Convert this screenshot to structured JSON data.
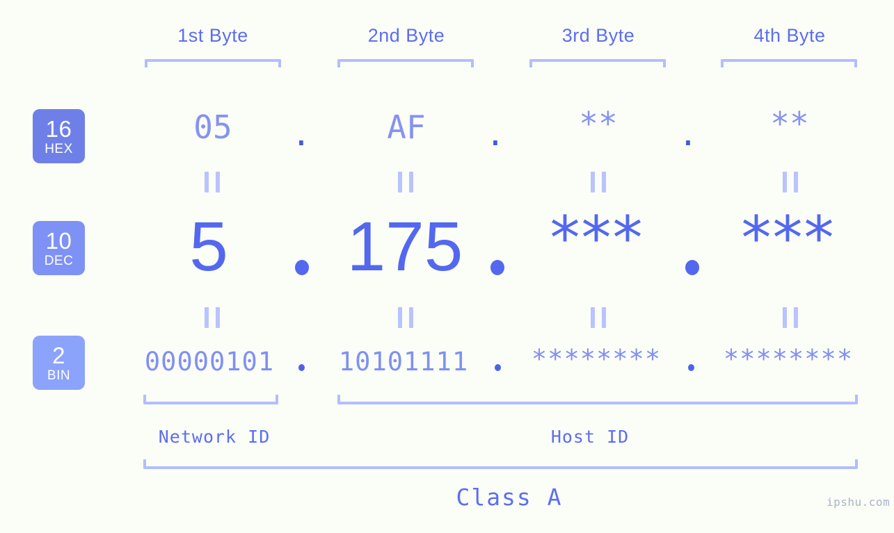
{
  "header": {
    "byte_labels": [
      "1st Byte",
      "2nd Byte",
      "3rd Byte",
      "4th Byte"
    ]
  },
  "rows": [
    {
      "badge_num": "16",
      "badge_sub": "HEX",
      "values": [
        "05",
        "AF",
        "**",
        "**"
      ],
      "separator": "."
    },
    {
      "badge_num": "10",
      "badge_sub": "DEC",
      "values": [
        "5",
        "175",
        "***",
        "***"
      ],
      "separator": "."
    },
    {
      "badge_num": "2",
      "badge_sub": "BIN",
      "values": [
        "00000101",
        "10101111",
        "********",
        "********"
      ],
      "separator": "."
    }
  ],
  "equivalence_mark": "||",
  "footer": {
    "network_id_label": "Network ID",
    "host_id_label": "Host ID",
    "class_label": "Class A"
  },
  "watermark": "ipshu.com",
  "colors": {
    "background": "#fbfdf7",
    "badge_hex": "#6e80e8",
    "badge_dec": "#7e92f5",
    "badge_bin": "#8ca3fb",
    "bracket": "#b3beff",
    "header_text": "#5b6ef0",
    "hex_text": "#8593f0",
    "dec_text": "#5368ef",
    "bin_text": "#7f90f3",
    "label_text": "#5c6ef0",
    "watermark_text": "#a9b4c9"
  }
}
